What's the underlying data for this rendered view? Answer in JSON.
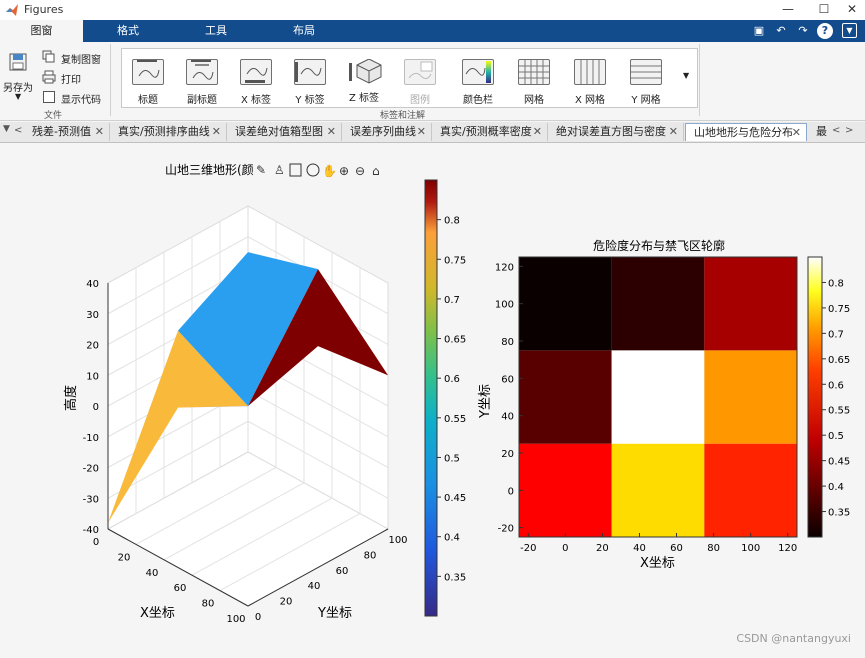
{
  "window": {
    "title": "Figures"
  },
  "ribbon_tabs": [
    "图窗",
    "格式",
    "工具",
    "布局"
  ],
  "file_group": {
    "save_as": "另存为",
    "copy_figure": "复制图窗",
    "print": "打印",
    "show_code": "显示代码",
    "label": "文件"
  },
  "annot_group": {
    "label": "标签和注解",
    "buttons": [
      "标题",
      "副标题",
      "X 标签",
      "Y 标签",
      "Z 标签",
      "图例",
      "颜色栏",
      "网格",
      "X 网格",
      "Y 网格"
    ]
  },
  "doc_tabs": [
    "残差-预测值",
    "真实/预测排序曲线",
    "误差绝对值箱型图",
    "误差序列曲线",
    "真实/预测概率密度",
    "绝对误差直方图与密度",
    "山地地形与危险分布",
    "最"
  ],
  "active_tab_index": 6,
  "colors": {
    "ribbon_tab_bar": "#124c8c",
    "accent": "#0072bd"
  },
  "chart_data": [
    {
      "type": "surface3d",
      "title": "山地三维地形(颜",
      "xlabel": "X坐标",
      "ylabel": "Y坐标",
      "zlabel": "高度",
      "x_ticks": [
        "0",
        "20",
        "40",
        "60",
        "80",
        "100"
      ],
      "y_ticks": [
        "0",
        "20",
        "40",
        "60",
        "80",
        "100"
      ],
      "z_ticks": [
        "40",
        "30",
        "20",
        "10",
        "0",
        "-10",
        "-20",
        "-30",
        "-40"
      ],
      "xlim": [
        0,
        100
      ],
      "ylim": [
        0,
        100
      ],
      "zlim": [
        -40,
        40
      ],
      "x": [
        0,
        50,
        100
      ],
      "y": [
        0,
        50,
        100
      ],
      "z": [
        [
          -38,
          12,
          25
        ],
        [
          12,
          0,
          32
        ],
        [
          25,
          32,
          10
        ]
      ],
      "colorbar_ticks": [
        "0.8",
        "0.75",
        "0.7",
        "0.65",
        "0.6",
        "0.55",
        "0.5",
        "0.45",
        "0.4",
        "0.35"
      ],
      "colorbar_range": [
        0.3,
        0.85
      ],
      "colormap": "parula"
    },
    {
      "type": "heatmap",
      "title": "危险度分布与禁飞区轮廓",
      "xlabel": "X坐标",
      "ylabel": "Y坐标",
      "x_ticks": [
        "-20",
        "0",
        "20",
        "40",
        "60",
        "80",
        "100",
        "120"
      ],
      "y_ticks": [
        "120",
        "100",
        "80",
        "60",
        "40",
        "20",
        "0",
        "-20"
      ],
      "xlim": [
        -25,
        125
      ],
      "ylim": [
        -25,
        125
      ],
      "x_centers": [
        0,
        50,
        100
      ],
      "y_centers": [
        0,
        50,
        100
      ],
      "values": [
        [
          0.52,
          0.71,
          0.55
        ],
        [
          0.37,
          0.85,
          0.65
        ],
        [
          0.3,
          0.33,
          0.44
        ]
      ],
      "colorbar_ticks": [
        "0.8",
        "0.75",
        "0.7",
        "0.65",
        "0.6",
        "0.55",
        "0.5",
        "0.45",
        "0.4",
        "0.35"
      ],
      "colorbar_range": [
        0.3,
        0.85
      ],
      "colormap": "hot"
    }
  ],
  "watermark": "CSDN @nantangyuxi"
}
